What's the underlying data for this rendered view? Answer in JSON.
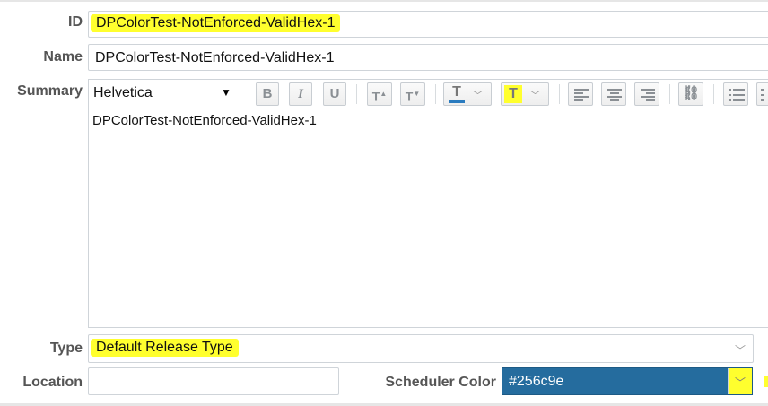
{
  "form": {
    "id_label": "ID",
    "id_value": "DPColorTest-NotEnforced-ValidHex-1",
    "name_label": "Name",
    "name_value": "DPColorTest-NotEnforced-ValidHex-1",
    "summary_label": "Summary",
    "summary_body": "DPColorTest-NotEnforced-ValidHex-1",
    "type_label": "Type",
    "type_value": "Default Release Type",
    "location_label": "Location",
    "location_value": "",
    "scheduler_color_label": "Scheduler Color",
    "scheduler_color_value": "#256c9e"
  },
  "toolbar": {
    "font_family": "Helvetica",
    "bold_glyph": "B",
    "italic_glyph": "I",
    "underline_glyph": "U",
    "text_color_glyph": "T",
    "highlight_glyph": "T"
  },
  "colors": {
    "highlight": "#ffff2e",
    "scheduler_swatch": "#256c9e",
    "text_color_underline": "#2a7bbf"
  },
  "icons": [
    "dropdown-triangle-icon",
    "bold-icon",
    "italic-icon",
    "underline-icon",
    "font-size-increase-icon",
    "font-size-decrease-icon",
    "text-color-icon",
    "chevron-down-icon",
    "highlight-color-icon",
    "align-left-icon",
    "align-center-icon",
    "align-right-icon",
    "link-icon",
    "numbered-list-icon",
    "bullet-list-icon"
  ]
}
